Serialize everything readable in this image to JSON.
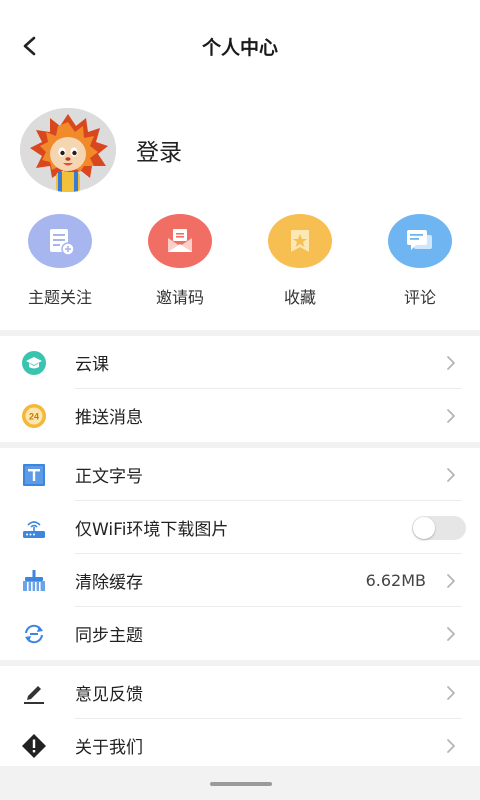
{
  "nav": {
    "title": "个人中心"
  },
  "profile": {
    "login_label": "登录"
  },
  "quick_actions": [
    {
      "label": "主题关注",
      "icon": "topic-follow-icon",
      "color": "#9fb2ee"
    },
    {
      "label": "邀请码",
      "icon": "invite-mail-icon",
      "color": "#f06e63"
    },
    {
      "label": "收藏",
      "icon": "star-bookmark-icon",
      "color": "#f7bf52"
    },
    {
      "label": "评论",
      "icon": "comment-icon",
      "color": "#6fb5f2"
    }
  ],
  "group1": [
    {
      "label": "云课",
      "icon": "graduation-cap-icon"
    },
    {
      "label": "推送消息",
      "icon": "push-24-icon",
      "badge": "24"
    }
  ],
  "group2": [
    {
      "label": "正文字号",
      "icon": "font-size-icon"
    },
    {
      "label": "仅WiFi环境下载图片",
      "icon": "wifi-router-icon",
      "toggle": false
    },
    {
      "label": "清除缓存",
      "icon": "broom-icon",
      "value": "6.62MB"
    },
    {
      "label": "同步主题",
      "icon": "sync-icon"
    }
  ],
  "group3": [
    {
      "label": "意见反馈",
      "icon": "pen-feedback-icon"
    },
    {
      "label": "关于我们",
      "icon": "info-diamond-icon"
    }
  ]
}
